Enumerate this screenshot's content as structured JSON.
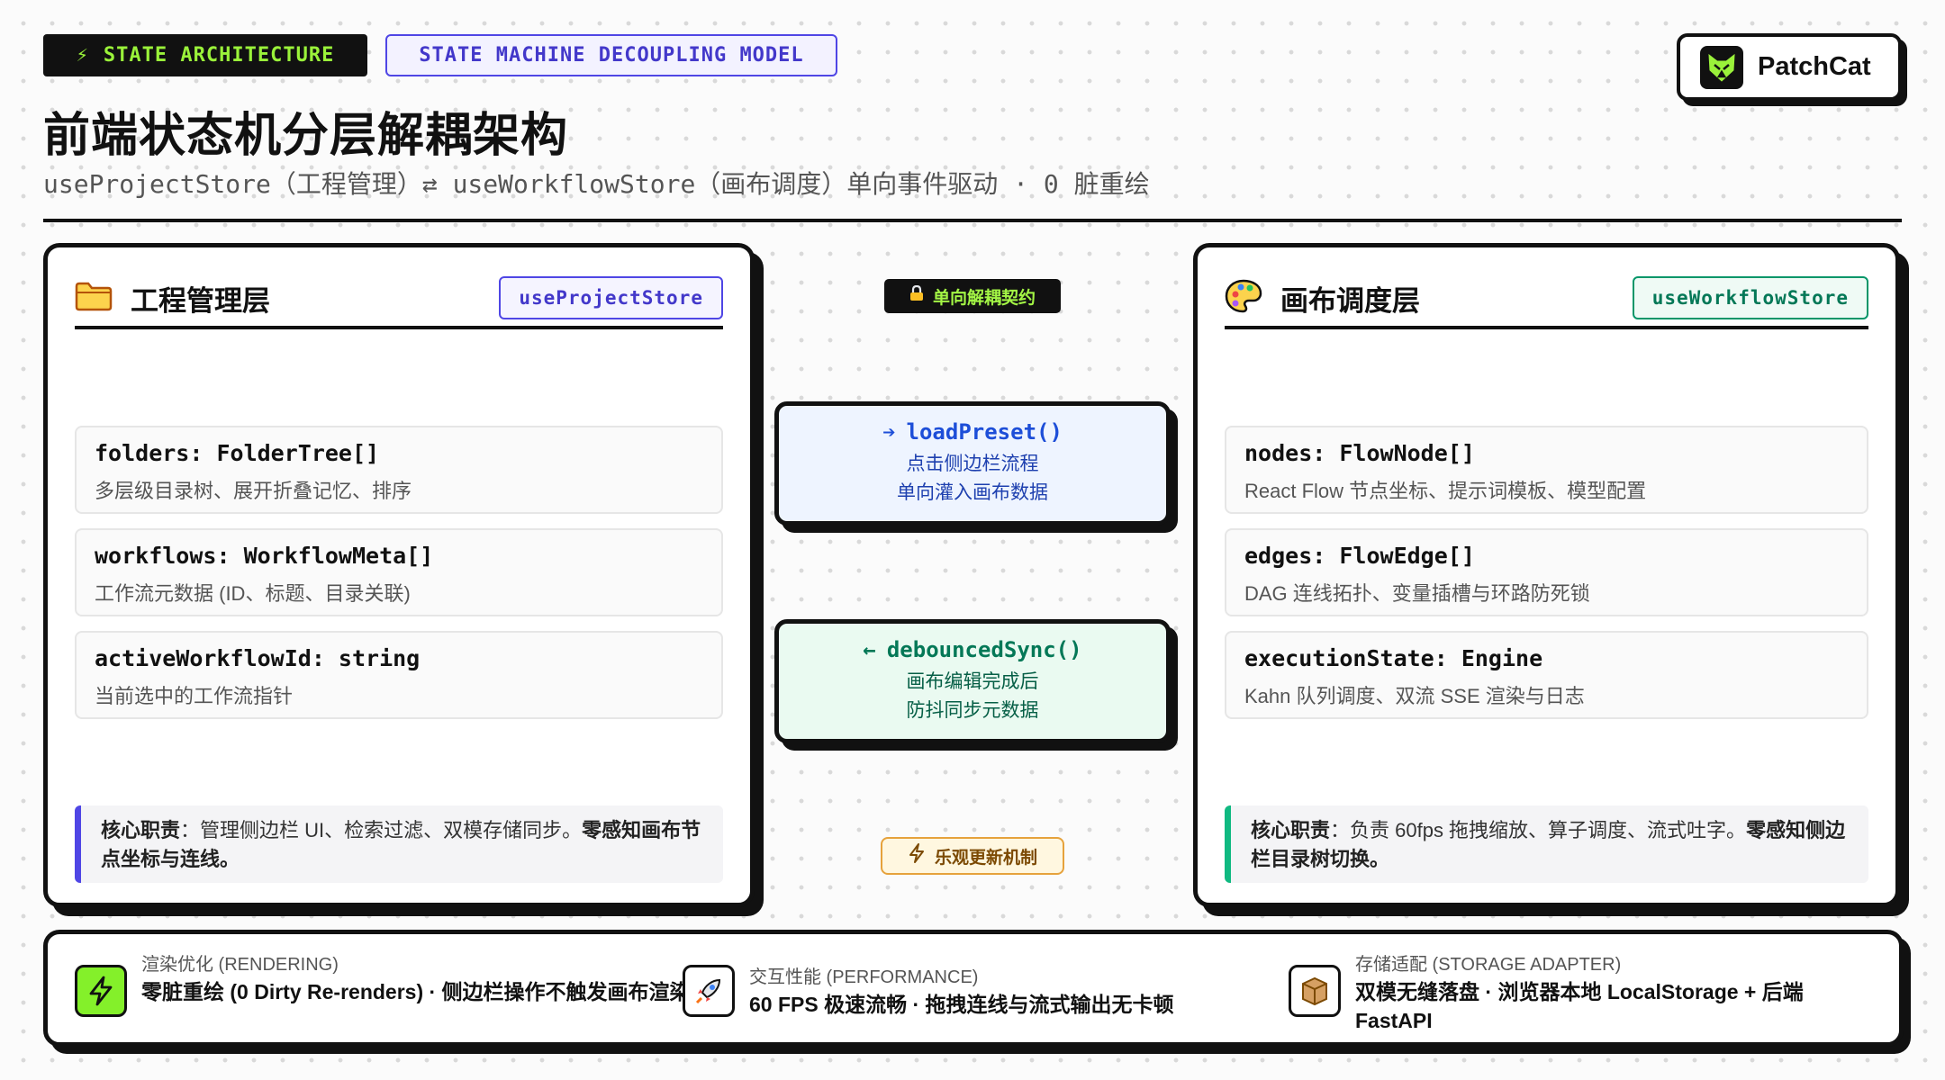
{
  "header": {
    "tag_primary": "STATE ARCHITECTURE",
    "tag_secondary": "STATE MACHINE DECOUPLING MODEL",
    "title": "前端状态机分层解耦架构",
    "subtitle": "useProjectStore（工程管理）⇄ useWorkflowStore（画布调度）单向事件驱动 · 0 脏重绘",
    "brand": "PatchCat"
  },
  "left_panel": {
    "title": "工程管理层",
    "store": "useProjectStore",
    "fields": [
      {
        "name": "folders: FolderTree[]",
        "desc": "多层级目录树、展开折叠记忆、排序"
      },
      {
        "name": "workflows: WorkflowMeta[]",
        "desc": "工作流元数据 (ID、标题、目录关联)"
      },
      {
        "name": "activeWorkflowId: string",
        "desc": "当前选中的工作流指针"
      }
    ],
    "duty_label": "核心职责",
    "duty_text": "：管理侧边栏 UI、检索过滤、双模存储同步。",
    "duty_emphasis": "零感知画布节点坐标与连线。"
  },
  "right_panel": {
    "title": "画布调度层",
    "store": "useWorkflowStore",
    "fields": [
      {
        "name": "nodes: FlowNode[]",
        "desc": "React Flow 节点坐标、提示词模板、模型配置"
      },
      {
        "name": "edges: FlowEdge[]",
        "desc": "DAG 连线拓扑、变量插槽与环路防死锁"
      },
      {
        "name": "executionState: Engine",
        "desc": "Kahn 队列调度、双流 SSE 渲染与日志"
      }
    ],
    "duty_label": "核心职责",
    "duty_text": "：负责 60fps 拖拽缩放、算子调度、流式吐字。",
    "duty_emphasis": "零感知侧边栏目录树切换。"
  },
  "center": {
    "contract_label": "单向解耦契约",
    "load": {
      "fn": "loadPreset()",
      "line1": "点击侧边栏流程",
      "line2": "单向灌入画布数据"
    },
    "sync": {
      "fn": "debouncedSync()",
      "line1": "画布编辑完成后",
      "line2": "防抖同步元数据"
    },
    "optimistic_label": "乐观更新机制"
  },
  "bottom": [
    {
      "label": "渲染优化 (RENDERING)",
      "main": "零脏重绘 (0 Dirty Re-renders) · 侧边栏操作不触发画布渲染",
      "icon": "lightning-icon"
    },
    {
      "label": "交互性能 (PERFORMANCE)",
      "main": "60 FPS 极速流畅 · 拖拽连线与流式输出无卡顿",
      "icon": "rocket-icon"
    },
    {
      "label": "存储适配 (STORAGE ADAPTER)",
      "main": "双模无缝落盘 · 浏览器本地 LocalStorage + 后端 FastAPI",
      "icon": "box-icon"
    }
  ],
  "colors": {
    "accent_green": "#9af23a",
    "indigo": "#4f46e5",
    "emerald": "#10b981",
    "amber": "#e6a23c"
  }
}
